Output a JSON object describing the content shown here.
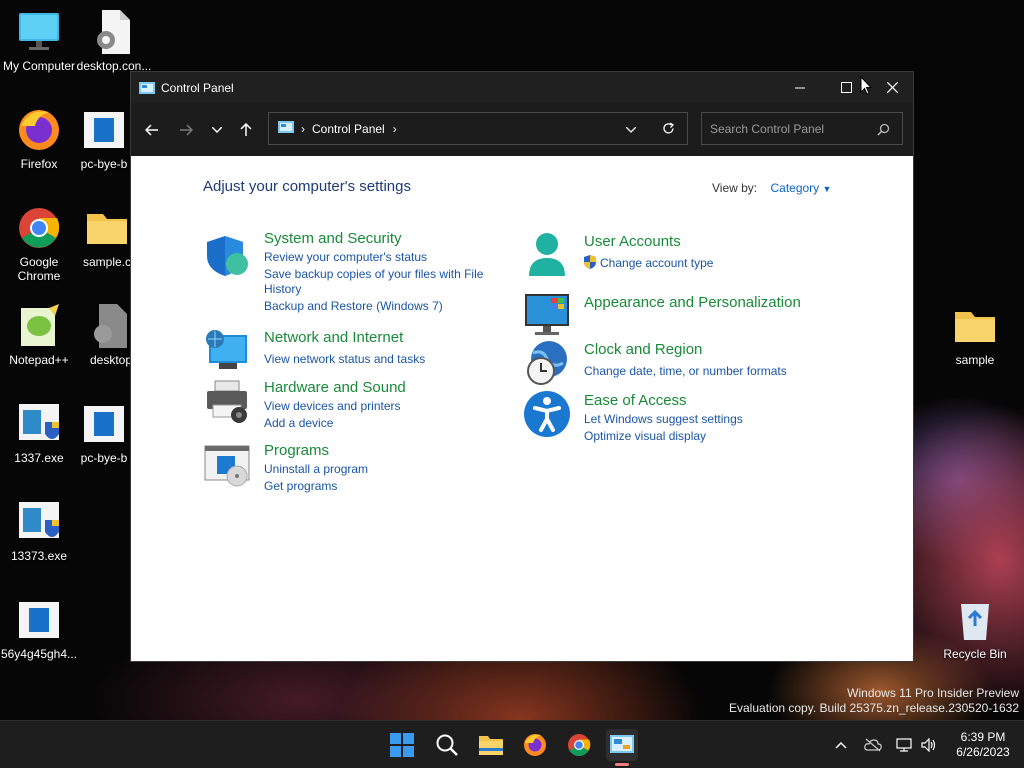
{
  "desktop": {
    "icons": [
      {
        "label": "My Computer",
        "icon": "monitor-icon"
      },
      {
        "label": "desktop.con...",
        "icon": "settings-file-icon"
      },
      {
        "label": "Firefox",
        "icon": "firefox-icon"
      },
      {
        "label": "pc-bye-b",
        "icon": "app-file-icon"
      },
      {
        "label": "Google Chrome",
        "icon": "chrome-icon"
      },
      {
        "label": "sample.c",
        "icon": "folder-icon"
      },
      {
        "label": "Notepad++",
        "icon": "notepadpp-icon"
      },
      {
        "label": "desktop",
        "icon": "settings-file-icon"
      },
      {
        "label": "1337.exe",
        "icon": "installer-icon"
      },
      {
        "label": "pc-bye-b",
        "icon": "app-file-icon"
      },
      {
        "label": "13373.exe",
        "icon": "installer-icon"
      },
      {
        "label": "56y4g45gh4...",
        "icon": "app-file-icon"
      },
      {
        "label": "sample",
        "icon": "folder-icon"
      },
      {
        "label": "Recycle Bin",
        "icon": "recycle-bin-icon"
      }
    ],
    "watermark": {
      "line1": "Windows 11 Pro Insider Preview",
      "line2": "Evaluation copy. Build 25375.zn_release.230520-1632"
    }
  },
  "window": {
    "title": "Control Panel",
    "breadcrumb": "Control Panel",
    "search_placeholder": "Search Control Panel",
    "heading": "Adjust your computer's settings",
    "view_by_label": "View by:",
    "view_by_value": "Category",
    "categories": [
      {
        "title": "System and Security",
        "links": [
          "Review your computer's status",
          "Save backup copies of your files with File",
          "History",
          "Backup and Restore (Windows 7)"
        ]
      },
      {
        "title": "Network and Internet",
        "links": [
          "View network status and tasks"
        ]
      },
      {
        "title": "Hardware and Sound",
        "links": [
          "View devices and printers",
          "Add a device"
        ]
      },
      {
        "title": "Programs",
        "links": [
          "Uninstall a program",
          "Get programs"
        ]
      },
      {
        "title": "User Accounts",
        "links": [
          "Change account type"
        ]
      },
      {
        "title": "Appearance and Personalization",
        "links": []
      },
      {
        "title": "Clock and Region",
        "links": [
          "Change date, time, or number formats"
        ]
      },
      {
        "title": "Ease of Access",
        "links": [
          "Let Windows suggest settings",
          "Optimize visual display"
        ]
      }
    ]
  },
  "taskbar": {
    "time": "6:39 PM",
    "date": "6/26/2023"
  },
  "colors": {
    "category_title": "#1a8a3a",
    "link": "#1a55a5",
    "heading": "#1e3a78",
    "titlebar": "#202020"
  }
}
